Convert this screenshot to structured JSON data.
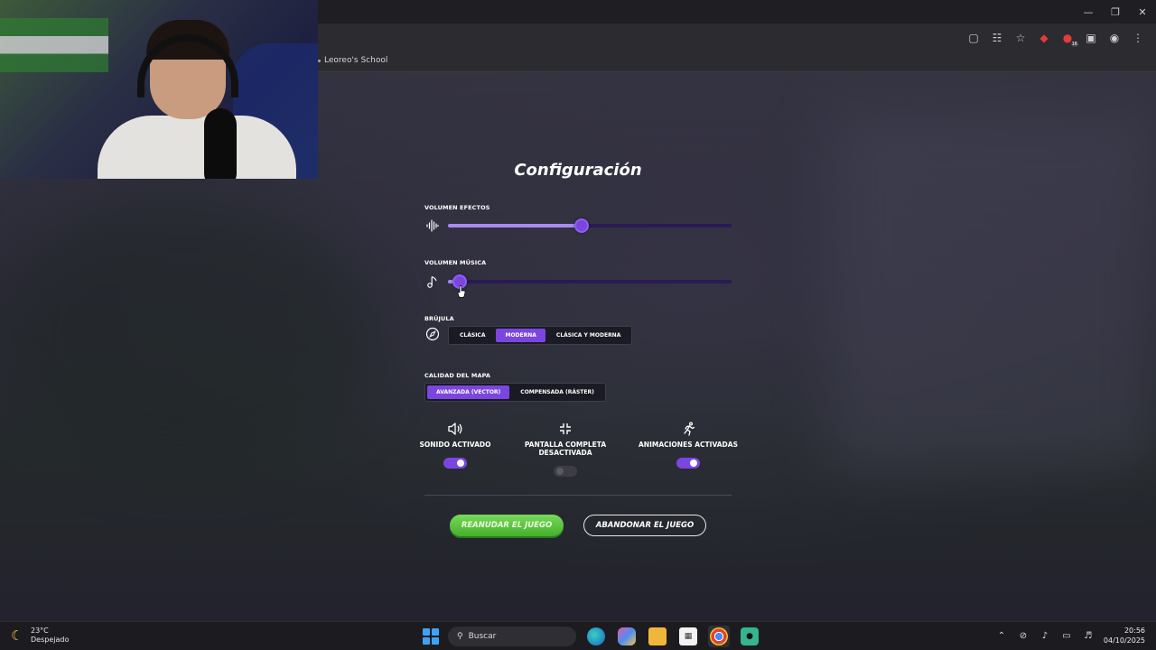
{
  "browser": {
    "bookmark_label": "Leoreo's School",
    "window_controls": [
      "minimize-icon",
      "restore-icon",
      "close-icon"
    ],
    "toolbar_icons": [
      "cast-icon",
      "translate-icon",
      "star-icon",
      "extension-red-icon",
      "extension-badge-icon",
      "puzzle-icon",
      "profile-icon",
      "kebab-menu-icon"
    ],
    "badge_count": "16"
  },
  "settings": {
    "title": "Configuración",
    "effects_volume": {
      "label": "Volumen efectos",
      "value": 0.47
    },
    "music_volume": {
      "label": "Volumen música",
      "value": 0.04
    },
    "compass": {
      "label": "Brújula",
      "options": [
        "Clásica",
        "Moderna",
        "Clásica y moderna"
      ],
      "selected": "Moderna"
    },
    "map_quality": {
      "label": "Calidad del mapa",
      "options": [
        "Avanzada (vector)",
        "Compensada (ráster)"
      ],
      "selected": "Avanzada (vector)"
    },
    "toggles": [
      {
        "label": "Sonido activado",
        "icon": "speaker-icon",
        "on": true
      },
      {
        "label": "Pantalla completa desactivada",
        "icon": "fullscreen-exit-icon",
        "on": false
      },
      {
        "label": "Animaciones activadas",
        "icon": "running-figure-icon",
        "on": true
      }
    ],
    "resume_button": "Reanudar el juego",
    "quit_button": "Abandonar el juego",
    "accent_color": "#7b46e0",
    "resume_color": "#5cc43f"
  },
  "taskbar": {
    "weather_temp": "23°C",
    "weather_desc": "Despejado",
    "search_placeholder": "Buscar",
    "time": "20:56",
    "date": "04/10/2025"
  }
}
